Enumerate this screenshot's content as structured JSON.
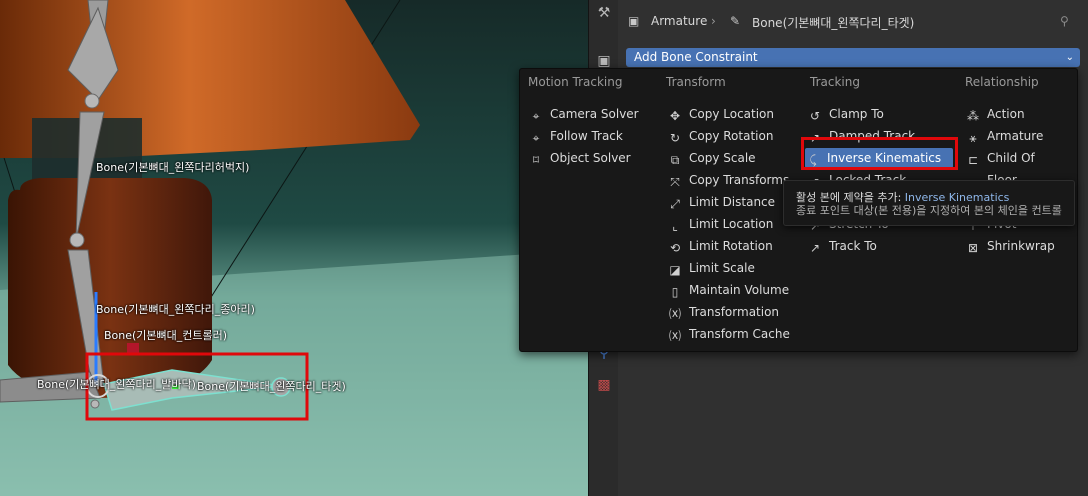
{
  "viewport": {
    "bone_labels": [
      "Bone(기본뼈대_왼쪽다리허벅지)",
      "Bone(기본뼈대_왼쪽다리_종아리)",
      "Bone(기본뼈대_컨트롤러)",
      "Bone(기본뼈대_왼쪽다리_발바닥)",
      "Bone(기본뼈대_왼쪽다리_타겟)"
    ],
    "highlight_color": "#e0080b"
  },
  "properties": {
    "breadcrumb": {
      "object": "Armature",
      "separator": "›",
      "bone": "Bone(기본뼈대_왼쪽다리_타겟)"
    },
    "add_constraint_label": "Add Bone Constraint",
    "accent_color": "#4772b3"
  },
  "menu": {
    "columns": [
      {
        "heading": "Motion Tracking",
        "items": [
          {
            "label": "Camera Solver",
            "icon": "camera-solver-icon"
          },
          {
            "label": "Follow Track",
            "icon": "follow-track-icon"
          },
          {
            "label": "Object Solver",
            "icon": "object-solver-icon"
          }
        ]
      },
      {
        "heading": "Transform",
        "items": [
          {
            "label": "Copy Location",
            "icon": "copy-location-icon"
          },
          {
            "label": "Copy Rotation",
            "icon": "copy-rotation-icon"
          },
          {
            "label": "Copy Scale",
            "icon": "copy-scale-icon"
          },
          {
            "label": "Copy Transforms",
            "icon": "copy-transforms-icon"
          },
          {
            "label": "Limit Distance",
            "icon": "limit-distance-icon"
          },
          {
            "label": "Limit Location",
            "icon": "limit-location-icon"
          },
          {
            "label": "Limit Rotation",
            "icon": "limit-rotation-icon"
          },
          {
            "label": "Limit Scale",
            "icon": "limit-scale-icon"
          },
          {
            "label": "Maintain Volume",
            "icon": "maintain-volume-icon"
          },
          {
            "label": "Transformation",
            "icon": "transformation-icon"
          },
          {
            "label": "Transform Cache",
            "icon": "transform-cache-icon"
          }
        ]
      },
      {
        "heading": "Tracking",
        "items": [
          {
            "label": "Clamp To",
            "icon": "clamp-to-icon"
          },
          {
            "label": "Damped Track",
            "icon": "damped-track-icon"
          },
          {
            "label": "Inverse Kinematics",
            "icon": "inverse-kinematics-icon",
            "active": true
          },
          {
            "label": "Locked Track",
            "icon": "locked-track-icon"
          },
          {
            "label": "",
            "icon": "spline-ik-icon"
          },
          {
            "label": "Stretch To",
            "icon": "stretch-to-icon"
          },
          {
            "label": "Track To",
            "icon": "track-to-icon"
          }
        ]
      },
      {
        "heading": "Relationship",
        "items": [
          {
            "label": "Action",
            "icon": "action-icon"
          },
          {
            "label": "Armature",
            "icon": "armature-icon"
          },
          {
            "label": "Child Of",
            "icon": "child-of-icon"
          },
          {
            "label": "Floor",
            "icon": "floor-icon"
          },
          {
            "label": "",
            "icon": "follow-path-icon"
          },
          {
            "label": "Pivot",
            "icon": "pivot-icon"
          },
          {
            "label": "Shrinkwrap",
            "icon": "shrinkwrap-icon"
          }
        ]
      }
    ]
  },
  "tooltip": {
    "line1_prefix": "활성 본에 제약을 추가:",
    "line1_value": "Inverse Kinematics",
    "line2": "종료 포인트 대상(본 전용)을 지정하여 본의 체인을 컨트롤"
  }
}
